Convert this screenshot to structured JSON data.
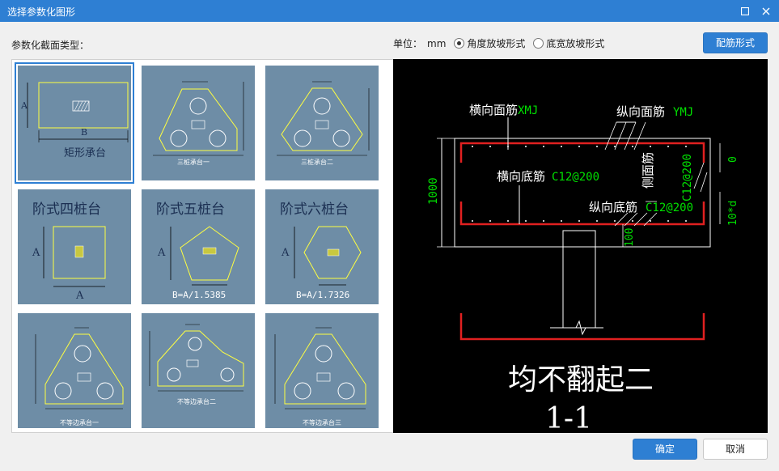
{
  "window": {
    "title": "选择参数化图形",
    "icons": [
      "restore-icon",
      "close-icon"
    ]
  },
  "top": {
    "type_label": "参数化截面类型：",
    "unit_label": "单位：",
    "unit_value": "mm",
    "radio_angle": "角度放坡形式",
    "radio_width": "底宽放坡形式",
    "selected_radio": "角度放坡形式",
    "rebar_button": "配筋形式"
  },
  "shapes": [
    {
      "caption": "矩形承台",
      "label_a": "A",
      "label_b": "B",
      "selected": true
    },
    {
      "caption": "三桩承台一",
      "selected": false
    },
    {
      "caption": "三桩承台二",
      "selected": false
    },
    {
      "title": "阶式四桩台",
      "label_a": "A",
      "label_b": "A",
      "selected": false
    },
    {
      "title": "阶式五桩台",
      "label_a": "A",
      "formula": "B=A/1.5385",
      "selected": false
    },
    {
      "title": "阶式六桩台",
      "label_a": "A",
      "formula": "B=A/1.7326",
      "selected": false
    },
    {
      "caption": "不等边承台一",
      "selected": false
    },
    {
      "caption": "不等边承台二",
      "selected": false
    },
    {
      "caption": "不等边承台三",
      "selected": false
    }
  ],
  "preview": {
    "top_transverse": "横向面筋",
    "top_transverse_val": "XMJ",
    "top_longitudinal": "纵向面筋",
    "top_longitudinal_val": "YMJ",
    "bottom_transverse": "横向底筋",
    "bottom_transverse_val": "C12@200",
    "side_rebar": "侧面筋",
    "side_rebar_val": "C12@200",
    "bottom_longitudinal": "纵向底筋",
    "bottom_longitudinal_val": "C12@200",
    "height": "1000",
    "cover_100": "100",
    "zero": "0",
    "ten_d": "10*d",
    "title": "均不翻起二",
    "section": "1-1",
    "colors": {
      "text": "#ffffff",
      "value": "#00e000",
      "rebar": "#e02020",
      "line": "#ffffff"
    }
  },
  "buttons": {
    "ok": "确定",
    "cancel": "取消"
  }
}
